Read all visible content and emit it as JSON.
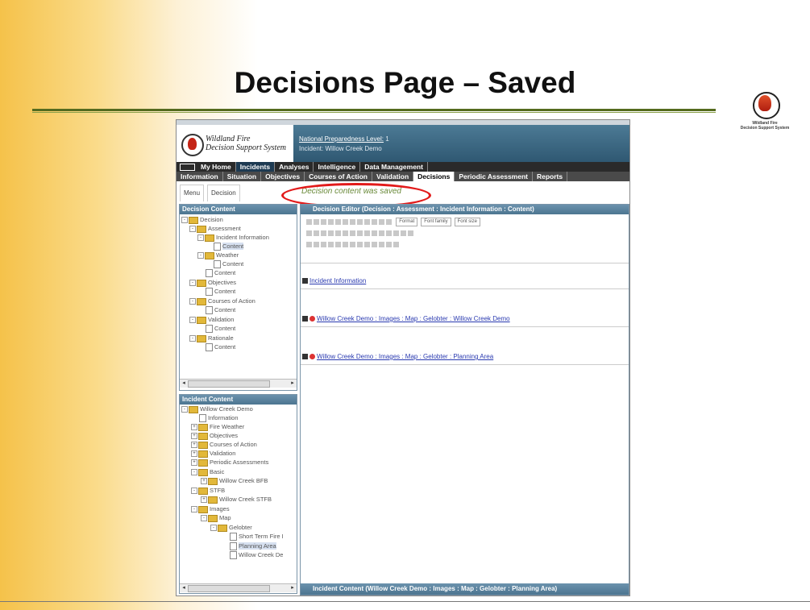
{
  "slide": {
    "title": "Decisions Page – Saved",
    "logo_text1": "Wildland Fire",
    "logo_text2": "Decision Support System"
  },
  "app": {
    "title_line1": "Wildland Fire",
    "title_line2": "Decision Support System",
    "npl_label": "National Preparedness Level:",
    "npl_value": "1",
    "incident": "Incident: Willow Creek Demo"
  },
  "nav_main": [
    {
      "label": "My Home"
    },
    {
      "label": "Incidents"
    },
    {
      "label": "Analyses"
    },
    {
      "label": "Intelligence"
    },
    {
      "label": "Data Management"
    }
  ],
  "nav_sub": [
    {
      "label": "Information"
    },
    {
      "label": "Situation"
    },
    {
      "label": "Objectives"
    },
    {
      "label": "Courses of Action"
    },
    {
      "label": "Validation"
    },
    {
      "label": "Decisions"
    },
    {
      "label": "Periodic Assessment"
    },
    {
      "label": "Reports"
    }
  ],
  "tabs": [
    {
      "label": "Menu"
    },
    {
      "label": "Decision"
    }
  ],
  "status_message": "Decision content was saved",
  "decision_panel": {
    "title": "Decision Content",
    "nodes": [
      "Decision",
      "Assessment",
      "Incident Information",
      "Content",
      "Weather",
      "Content",
      "Content",
      "Objectives",
      "Content",
      "Courses of Action",
      "Content",
      "Validation",
      "Content",
      "Rationale",
      "Content"
    ]
  },
  "incident_panel": {
    "title": "Incident Content",
    "nodes": [
      "Willow Creek Demo",
      "Information",
      "Fire Weather",
      "Objectives",
      "Courses of Action",
      "Validation",
      "Periodic Assessments",
      "Basic",
      "Willow Creek BFB",
      "STFB",
      "Willow Creek STFB",
      "Images",
      "Map",
      "Gelobter",
      "Short Term Fire I",
      "Planning Area",
      "Willow Creek De"
    ]
  },
  "editor": {
    "title": "Decision Editor (Decision : Assessment : Incident Information : Content)",
    "format_label": "Format",
    "font_family_label": "Font family",
    "font_size_label": "Font size",
    "entries": [
      "Incident Information",
      "Willow Creek Demo : Images : Map : Gelobter : Willow Creek Demo",
      "Willow Creek Demo : Images : Map : Gelobter : Planning Area"
    ],
    "footer": "Incident Content (Willow Creek Demo : Images : Map : Gelobter : Planning Area)"
  }
}
